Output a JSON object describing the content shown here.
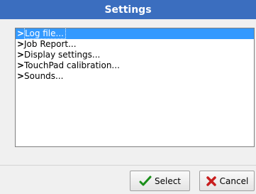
{
  "window": {
    "title": "Settings"
  },
  "list": {
    "items": [
      {
        "label": "Log file...",
        "selected": true
      },
      {
        "label": "Job Report...",
        "selected": false
      },
      {
        "label": "Display settings...",
        "selected": false
      },
      {
        "label": "TouchPad calibration...",
        "selected": false
      },
      {
        "label": "Sounds...",
        "selected": false
      }
    ],
    "marker": ">"
  },
  "buttons": {
    "select_label": "Select",
    "cancel_label": "Cancel",
    "select_icon": "checkmark-icon",
    "cancel_icon": "x-icon"
  },
  "colors": {
    "title_bar": "#3b6ebf",
    "selection": "#3399ff",
    "check": "#1a8f1a",
    "cancel_x": "#c81e1e"
  }
}
